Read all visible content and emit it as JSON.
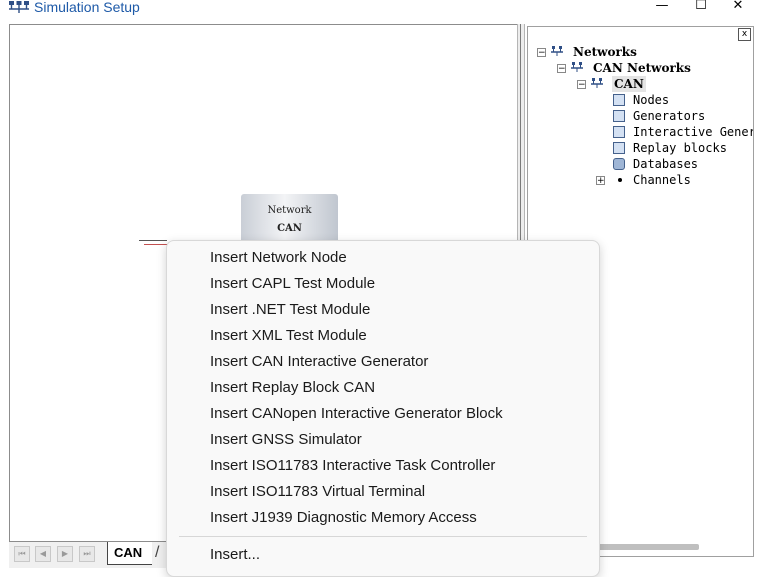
{
  "window": {
    "title": "Simulation Setup",
    "icon": "network-icon",
    "controls": {
      "minimize": "—",
      "maximize": "☐",
      "close": "✕"
    }
  },
  "canvas": {
    "network_block": {
      "line1": "Network",
      "line2": "CAN"
    }
  },
  "tabs": {
    "nav_first": "⏮",
    "nav_prev": "◀",
    "nav_next": "▶",
    "nav_last": "⏭",
    "items": [
      {
        "label": "CAN"
      }
    ]
  },
  "tree": {
    "close_label": "x",
    "items": [
      {
        "label": "Networks",
        "icon": "network-icon",
        "expander": "−"
      },
      {
        "label": "CAN Networks",
        "icon": "network-icon",
        "expander": "−"
      },
      {
        "label": "CAN",
        "icon": "network-icon",
        "expander": "−"
      },
      {
        "label": "Nodes",
        "icon": "node-icon"
      },
      {
        "label": "Generators",
        "icon": "generator-icon"
      },
      {
        "label": "Interactive Gener",
        "icon": "interactive-generator-icon"
      },
      {
        "label": "Replay blocks",
        "icon": "replay-icon"
      },
      {
        "label": "Databases",
        "icon": "database-icon"
      },
      {
        "label": "Channels",
        "icon": "channel-icon",
        "expander": "+"
      }
    ]
  },
  "context_menu": {
    "items": [
      "Insert Network Node",
      "Insert CAPL Test Module",
      "Insert .NET Test Module",
      "Insert XML Test Module",
      "Insert CAN Interactive Generator",
      "Insert Replay Block CAN",
      "Insert CANopen Interactive Generator Block",
      "Insert GNSS Simulator",
      "Insert ISO11783 Interactive Task Controller",
      "Insert ISO11783 Virtual Terminal",
      "Insert J1939 Diagnostic Memory Access"
    ],
    "footer_item": "Insert..."
  }
}
